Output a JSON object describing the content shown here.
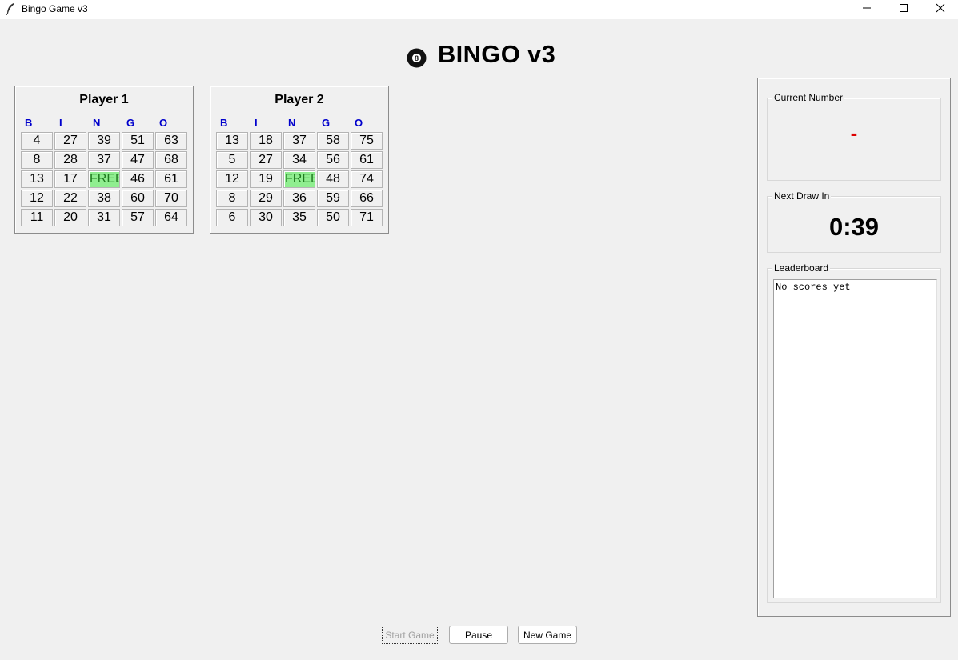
{
  "window": {
    "title": "Bingo Game v3",
    "icon": "feather-icon",
    "controls": [
      "minimize-icon",
      "maximize-icon",
      "close-icon"
    ]
  },
  "heading": {
    "icon": "eight-ball-icon",
    "title": "BINGO v3"
  },
  "columns": [
    "B",
    "I",
    "N",
    "G",
    "O"
  ],
  "players": [
    {
      "name": "Player 1",
      "grid": [
        [
          "4",
          "27",
          "39",
          "51",
          "63"
        ],
        [
          "8",
          "28",
          "37",
          "47",
          "68"
        ],
        [
          "13",
          "17",
          "FREE",
          "46",
          "61"
        ],
        [
          "12",
          "22",
          "38",
          "60",
          "70"
        ],
        [
          "11",
          "20",
          "31",
          "57",
          "64"
        ]
      ]
    },
    {
      "name": "Player 2",
      "grid": [
        [
          "13",
          "18",
          "37",
          "58",
          "75"
        ],
        [
          "5",
          "27",
          "34",
          "56",
          "61"
        ],
        [
          "12",
          "19",
          "FREE",
          "48",
          "74"
        ],
        [
          "8",
          "29",
          "36",
          "59",
          "66"
        ],
        [
          "6",
          "30",
          "35",
          "50",
          "71"
        ]
      ]
    }
  ],
  "side_panel": {
    "current_number_label": "Current Number",
    "current_number_value": "-",
    "next_draw_label": "Next Draw In",
    "next_draw_value": "0:39",
    "leaderboard_label": "Leaderboard",
    "leaderboard_text": "No scores yet"
  },
  "buttons": {
    "start": "Start Game",
    "pause": "Pause",
    "new_game": "New Game"
  },
  "colors": {
    "column_header": "#0000cc",
    "free_cell": "#90ee90",
    "current_number": "#dd0000"
  }
}
